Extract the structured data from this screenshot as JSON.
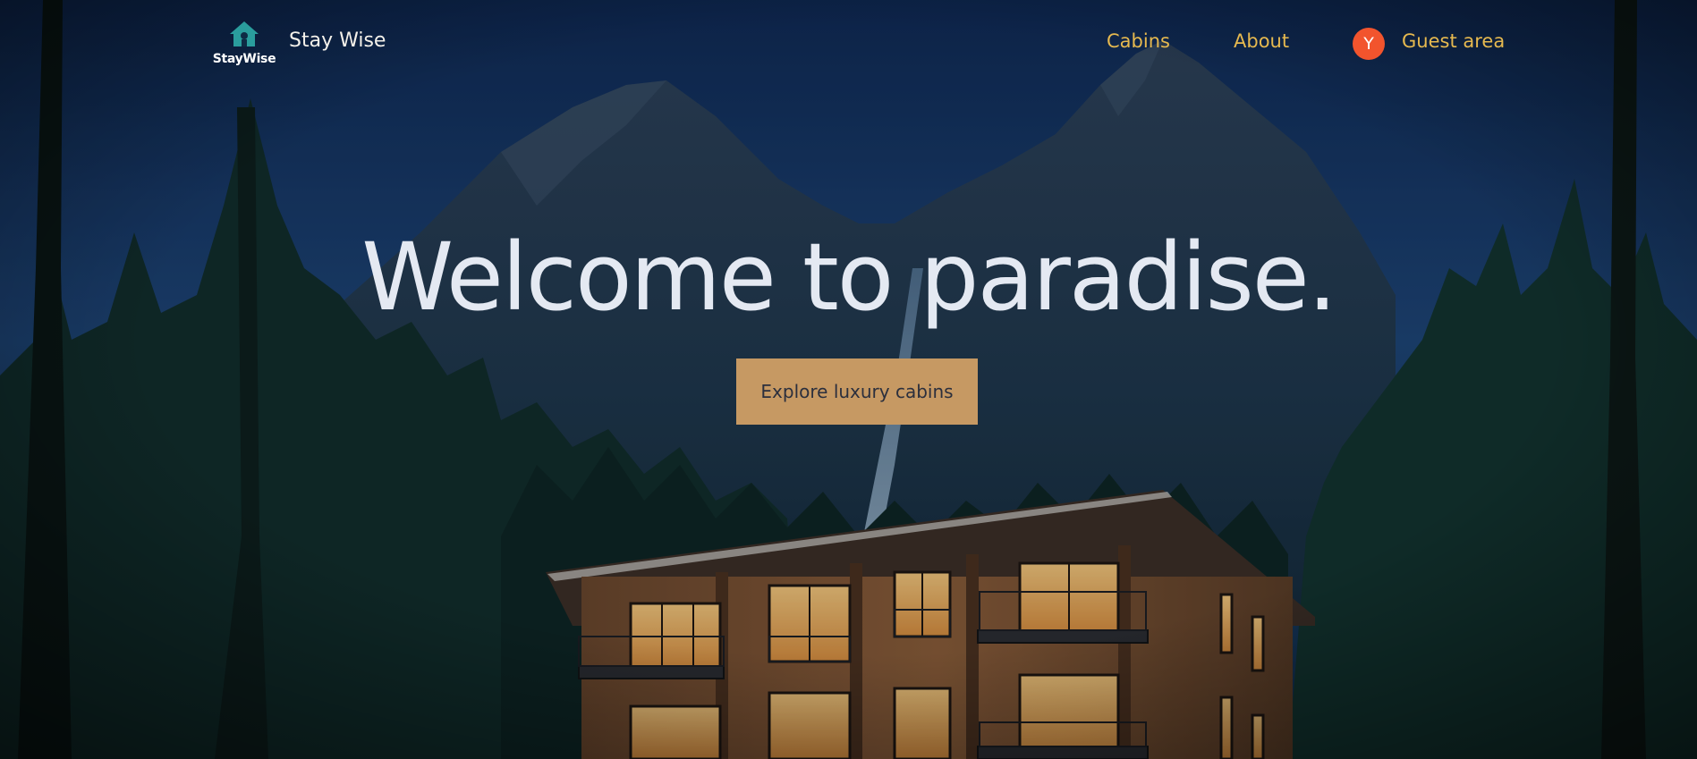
{
  "header": {
    "logo_text": "StayWise",
    "brand_name": "Stay Wise",
    "nav": {
      "cabins": "Cabins",
      "about": "About"
    },
    "guest": {
      "avatar_initial": "Y",
      "label": "Guest area"
    }
  },
  "hero": {
    "title": "Welcome to paradise.",
    "cta_label": "Explore luxury cabins"
  },
  "icons": {
    "logo": "house-icon"
  },
  "colors": {
    "nav_link": "#e6b94f",
    "avatar_bg": "#f2542d",
    "cta_bg": "#c69963",
    "cta_text": "#2b2f3d",
    "title": "#e4e9f2",
    "logo_icon": "#2a9d9d"
  }
}
